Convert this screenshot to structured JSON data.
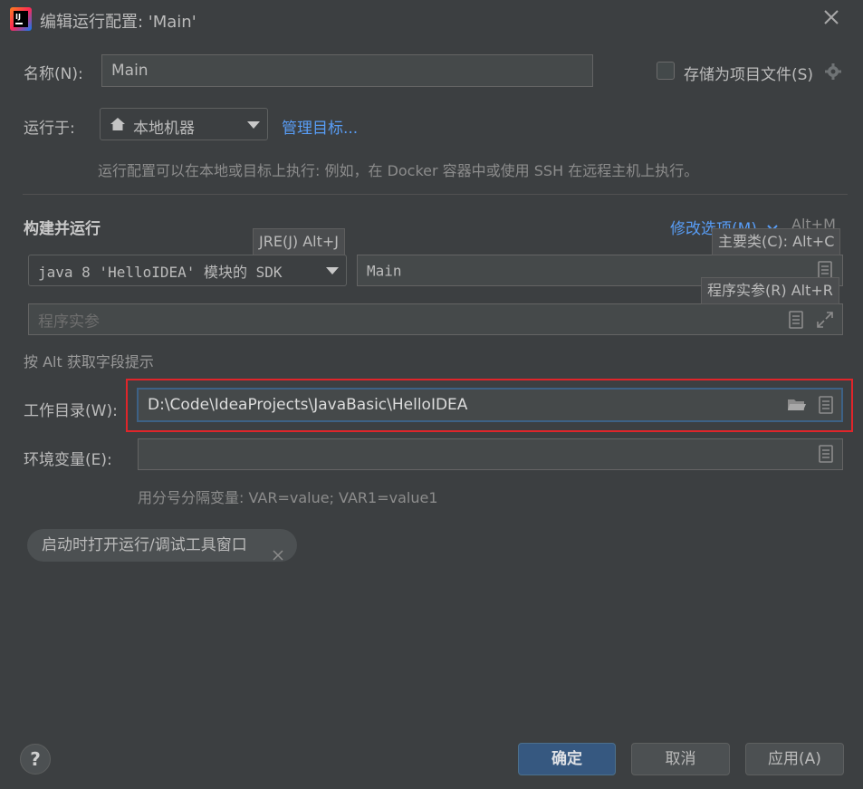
{
  "window": {
    "title": "编辑运行配置: 'Main'"
  },
  "name": {
    "label": "名称(N):",
    "value": "Main"
  },
  "store_as_project_file": {
    "label": "存储为项目文件(S)",
    "checked": false
  },
  "run_on": {
    "label": "运行于:",
    "value": "本地机器",
    "manage_link": "管理目标...",
    "hint": "运行配置可以在本地或目标上执行: 例如，在 Docker 容器中或使用 SSH 在远程主机上执行。"
  },
  "build_run": {
    "section_title": "构建并运行",
    "modify_options": "修改选项(M)",
    "modify_options_shortcut": "Alt+M",
    "sdk_value": "java 8 'HelloIDEA' 模块的 SDK",
    "main_class_value": "Main",
    "program_args_placeholder": "程序实参",
    "tooltip_jre": "JRE(J) Alt+J",
    "tooltip_main_class": "主要类(C): Alt+C",
    "tooltip_program_args": "程序实参(R) Alt+R",
    "alt_hint": "按 Alt 获取字段提示"
  },
  "working_dir": {
    "label": "工作目录(W):",
    "value": "D:\\Code\\IdeaProjects\\JavaBasic\\HelloIDEA"
  },
  "env_vars": {
    "label": "环境变量(E):",
    "value": "",
    "hint": "用分号分隔变量: VAR=value; VAR1=value1"
  },
  "chip": {
    "label": "启动时打开运行/调试工具窗口"
  },
  "buttons": {
    "ok": "确定",
    "cancel": "取消",
    "apply": "应用(A)"
  },
  "colors": {
    "background": "#3c3f41",
    "accent": "#589df6",
    "primary_button": "#365880",
    "highlight_box": "#e0252a"
  }
}
